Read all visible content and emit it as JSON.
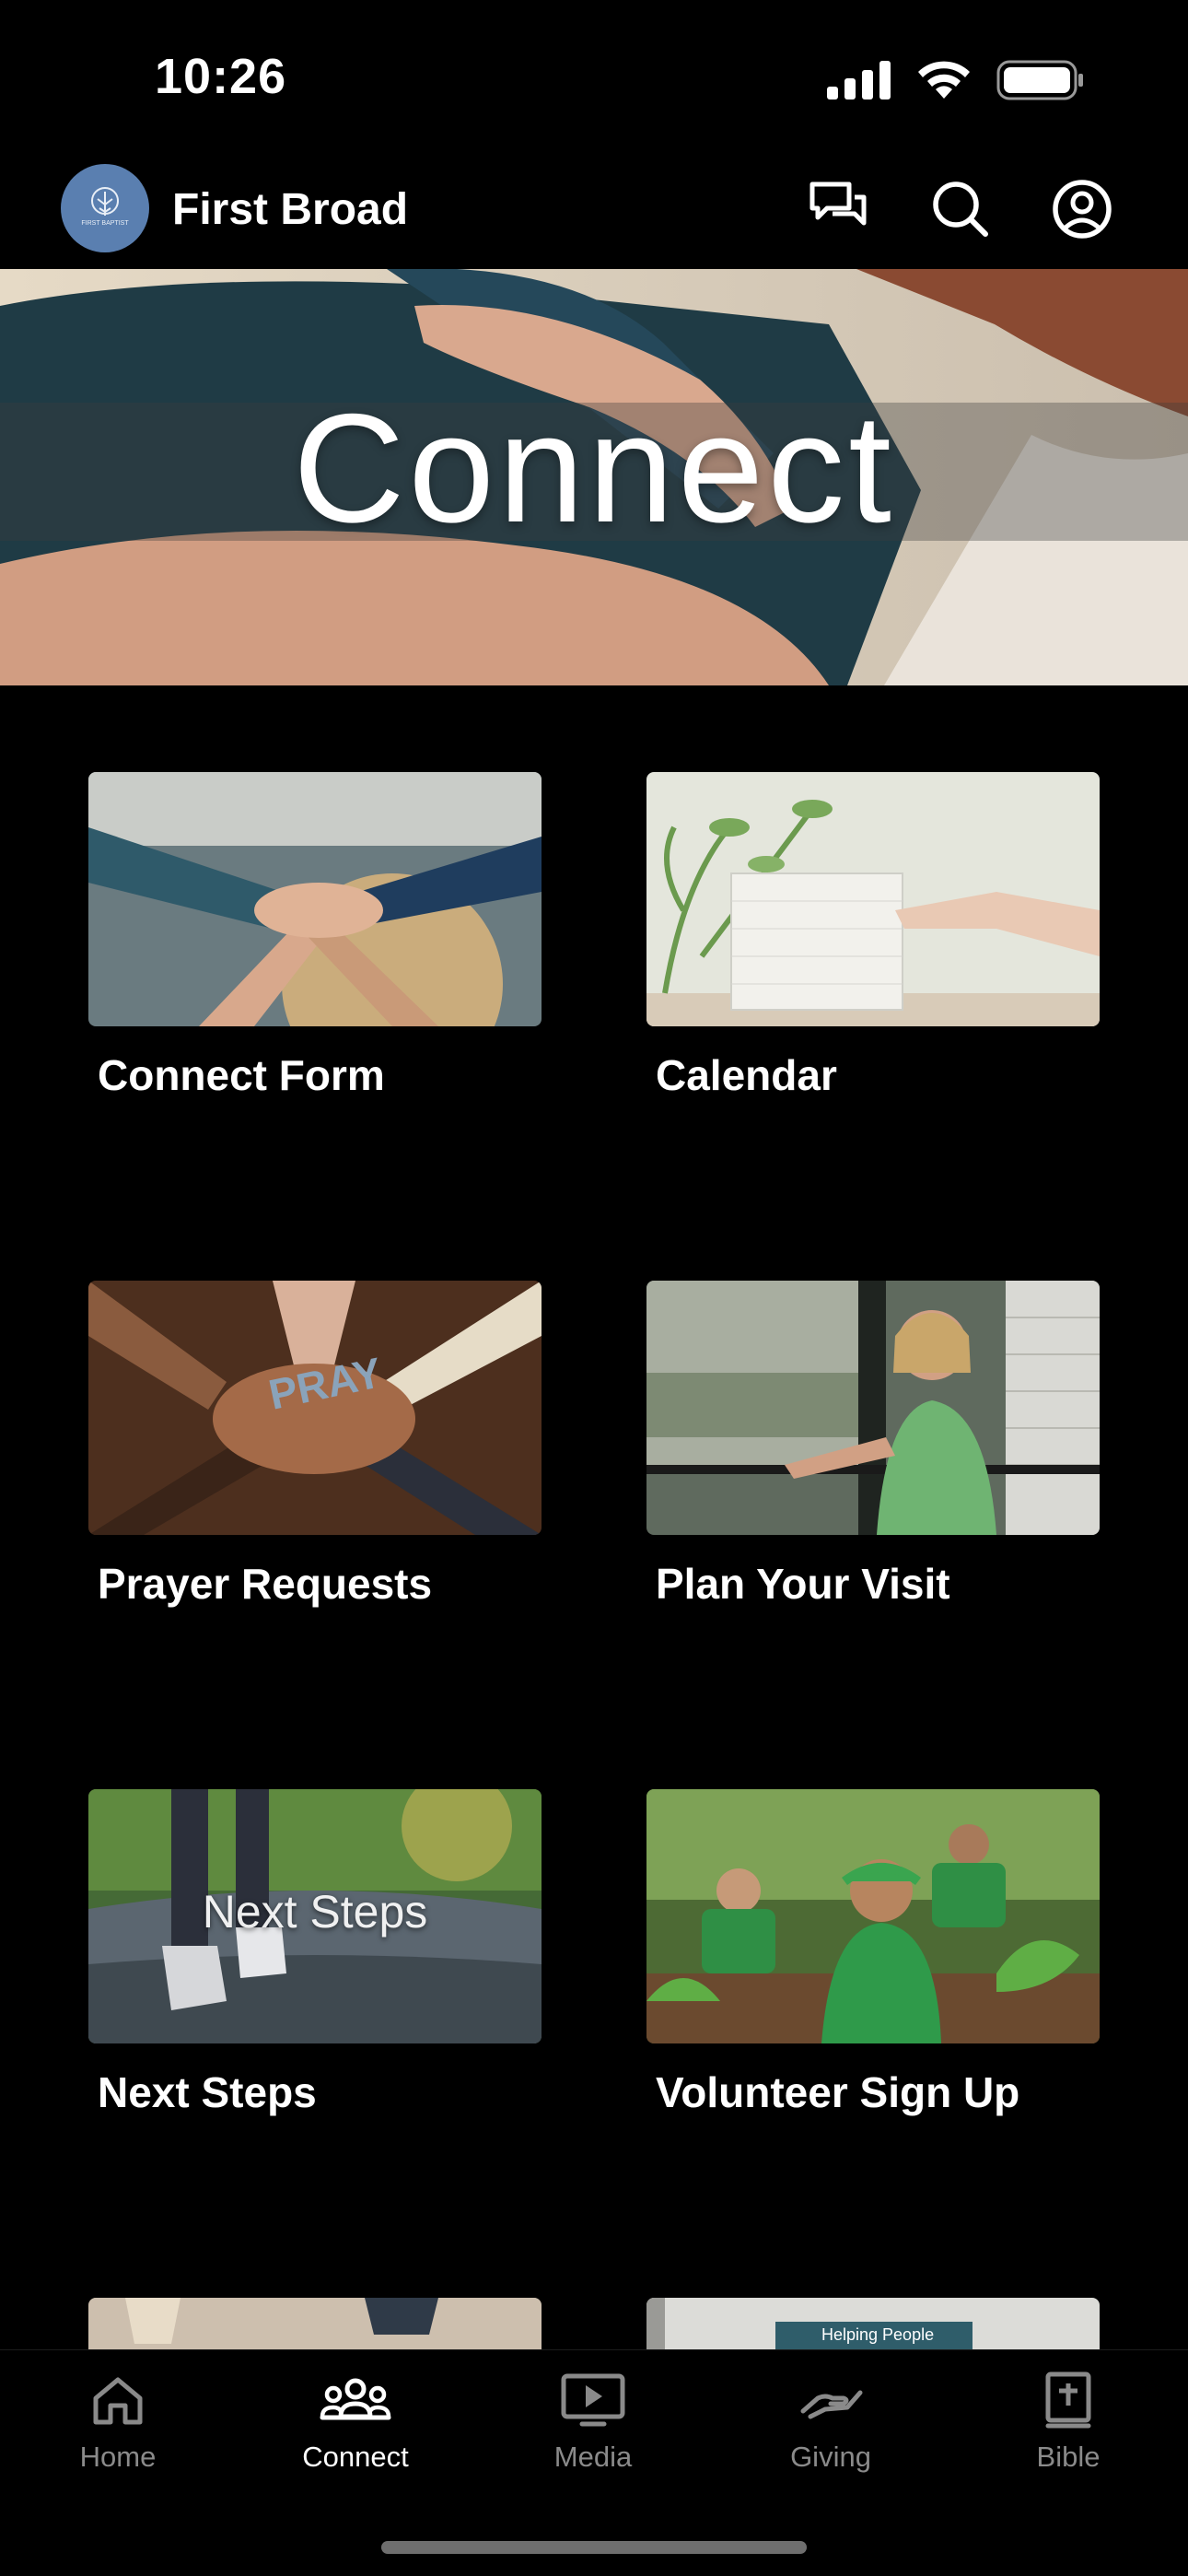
{
  "status_bar": {
    "time": "10:26"
  },
  "header": {
    "church_name": "First Broad",
    "logo_text": "FIRST BAPTIST"
  },
  "hero": {
    "title": "Connect"
  },
  "tiles": [
    {
      "label": "Connect Form"
    },
    {
      "label": "Calendar"
    },
    {
      "label": "Prayer Requests",
      "image_text": "PRAY"
    },
    {
      "label": "Plan Your Visit"
    },
    {
      "label": "Next Steps",
      "image_text": "Next Steps"
    },
    {
      "label": "Volunteer Sign Up"
    },
    {
      "label": ""
    },
    {
      "label": "",
      "image_text": "Helping People"
    }
  ],
  "nav": [
    {
      "label": "Home",
      "icon": "home-icon",
      "active": false
    },
    {
      "label": "Connect",
      "icon": "people-icon",
      "active": true
    },
    {
      "label": "Media",
      "icon": "media-icon",
      "active": false
    },
    {
      "label": "Giving",
      "icon": "giving-icon",
      "active": false
    },
    {
      "label": "Bible",
      "icon": "bible-icon",
      "active": false
    }
  ],
  "colors": {
    "background": "#000000",
    "accent_logo": "#5a7fb0",
    "nav_inactive": "#8a8a8a",
    "nav_active": "#ffffff"
  }
}
